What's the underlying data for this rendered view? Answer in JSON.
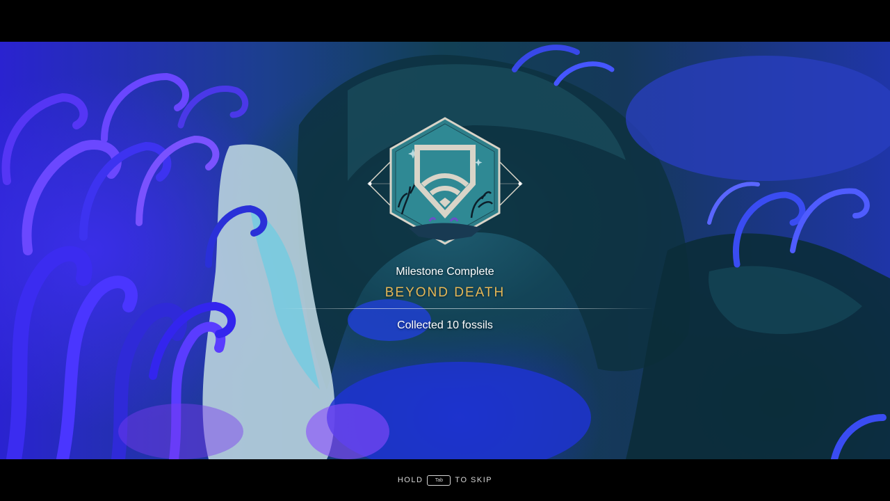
{
  "milestone": {
    "subtitle": "Milestone Complete",
    "title": "BEYOND DEATH",
    "description": "Collected 10 fossils",
    "badge_icon": "shield-signal-icon"
  },
  "skip_prompt": {
    "hold_label": "HOLD",
    "key_label": "Tab",
    "action_label": "TO SKIP"
  },
  "colors": {
    "title_gold": "#e6b857",
    "badge_fill": "#2e7f8a",
    "badge_border": "#d9d4c8",
    "letterbox": "#000000"
  }
}
